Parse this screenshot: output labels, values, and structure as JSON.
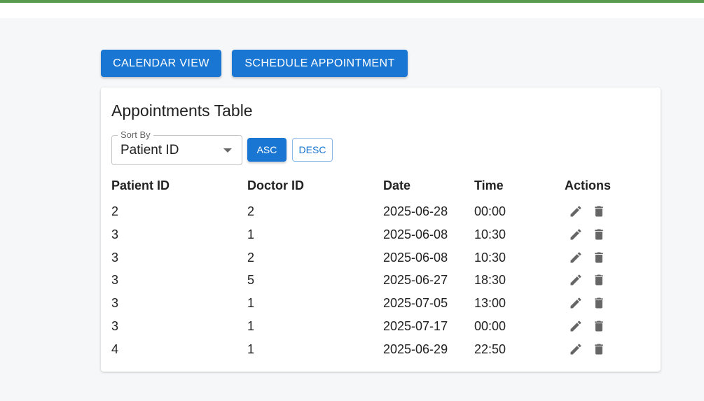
{
  "toolbar": {
    "calendar_view_label": "CALENDAR VIEW",
    "schedule_label": "SCHEDULE APPOINTMENT"
  },
  "card": {
    "title": "Appointments Table",
    "sort": {
      "label": "Sort By",
      "value": "Patient ID",
      "asc_label": "ASC",
      "desc_label": "DESC"
    },
    "columns": [
      "Patient ID",
      "Doctor ID",
      "Date",
      "Time",
      "Actions"
    ],
    "rows": [
      {
        "patient_id": "2",
        "doctor_id": "2",
        "date": "2025-06-28",
        "time": "00:00"
      },
      {
        "patient_id": "3",
        "doctor_id": "1",
        "date": "2025-06-08",
        "time": "10:30"
      },
      {
        "patient_id": "3",
        "doctor_id": "2",
        "date": "2025-06-08",
        "time": "10:30"
      },
      {
        "patient_id": "3",
        "doctor_id": "5",
        "date": "2025-06-27",
        "time": "18:30"
      },
      {
        "patient_id": "3",
        "doctor_id": "1",
        "date": "2025-07-05",
        "time": "13:00"
      },
      {
        "patient_id": "3",
        "doctor_id": "1",
        "date": "2025-07-17",
        "time": "00:00"
      },
      {
        "patient_id": "4",
        "doctor_id": "1",
        "date": "2025-06-29",
        "time": "22:50"
      }
    ],
    "row_icons": [
      "edit-icon",
      "delete-icon"
    ]
  },
  "colors": {
    "primary": "#1976d2",
    "top_bar": "#5a9a4e",
    "icon": "#666666"
  }
}
